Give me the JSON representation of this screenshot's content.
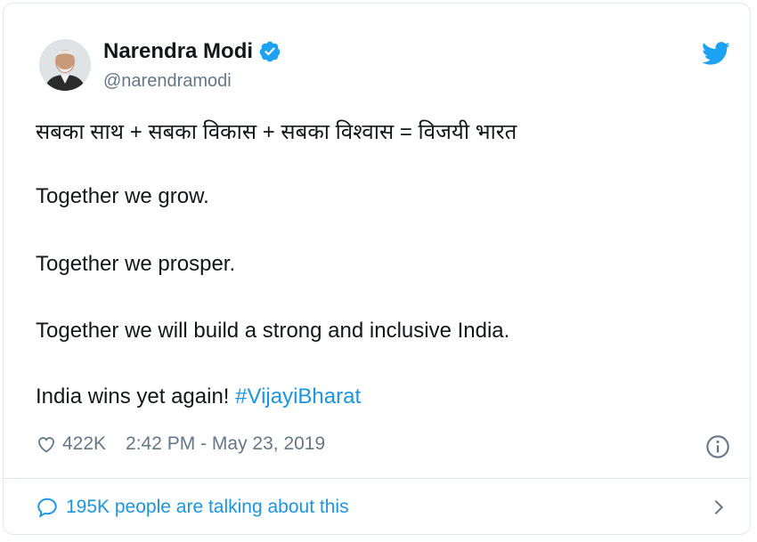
{
  "tweet": {
    "author_name": "Narendra Modi",
    "handle": "@narendramodi",
    "lines": [
      "सबका साथ + सबका विकास + सबका विश्वास = विजयी भारत",
      "Together we grow.",
      "Together we prosper.",
      "Together we will build a strong and inclusive India."
    ],
    "last_line_text": "India wins yet again!",
    "hashtag": "#VijayiBharat",
    "like_count": "422K",
    "timestamp": "2:42 PM - May 23, 2019",
    "talking_text": "195K people are talking about this"
  },
  "icons": {
    "verified": "verified-badge-icon",
    "bird": "twitter-bird-icon",
    "heart": "heart-icon",
    "info": "info-icon",
    "bubble": "speech-bubble-icon",
    "chevron": "chevron-right-icon"
  },
  "colors": {
    "accent": "#1b95e0",
    "verified": "#1da1f2",
    "muted": "#657786",
    "text": "#14171a"
  }
}
